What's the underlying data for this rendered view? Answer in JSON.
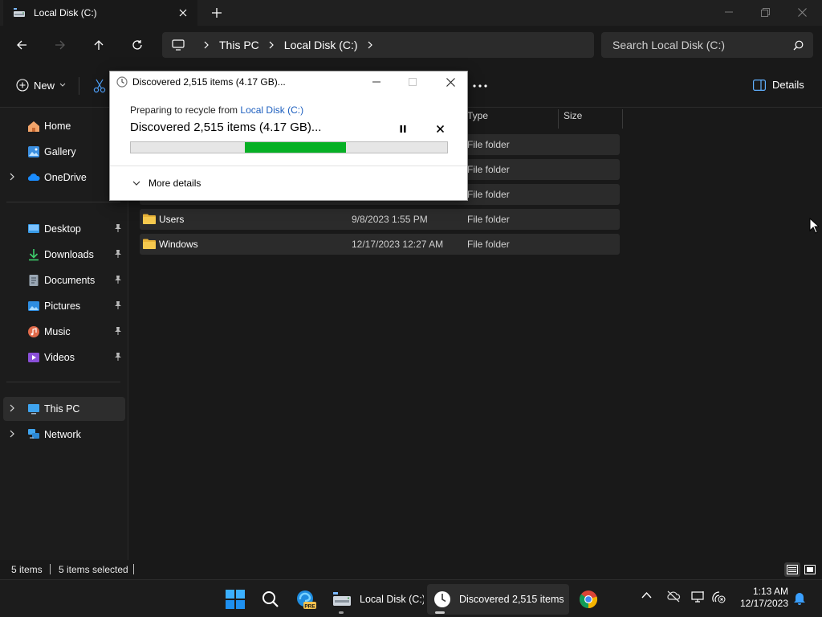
{
  "tab": {
    "title": "Local Disk (C:)"
  },
  "address": {
    "crumbs": [
      "This PC",
      "Local Disk (C:)"
    ]
  },
  "search": {
    "placeholder": "Search Local Disk (C:)"
  },
  "command_bar": {
    "new_label": "New",
    "details_label": "Details"
  },
  "sidebar": {
    "top": [
      {
        "label": "Home",
        "icon": "home-icon"
      },
      {
        "label": "Gallery",
        "icon": "gallery-icon"
      },
      {
        "label": "OneDrive",
        "icon": "onedrive-icon"
      }
    ],
    "pinned": [
      {
        "label": "Desktop",
        "icon": "desktop-icon"
      },
      {
        "label": "Downloads",
        "icon": "downloads-icon"
      },
      {
        "label": "Documents",
        "icon": "documents-icon"
      },
      {
        "label": "Pictures",
        "icon": "pictures-icon"
      },
      {
        "label": "Music",
        "icon": "music-icon"
      },
      {
        "label": "Videos",
        "icon": "videos-icon"
      }
    ],
    "bottom": [
      {
        "label": "This PC",
        "icon": "this-pc-icon",
        "selected": true
      },
      {
        "label": "Network",
        "icon": "network-icon"
      }
    ]
  },
  "file_list": {
    "columns": {
      "type": "Type",
      "size": "Size"
    },
    "rows": [
      {
        "name": "",
        "date": "",
        "type": "File folder"
      },
      {
        "name": "",
        "date": "",
        "type": "File folder"
      },
      {
        "name": "",
        "date": "",
        "type": "File folder"
      },
      {
        "name": "Users",
        "date": "9/8/2023 1:55 PM",
        "type": "File folder"
      },
      {
        "name": "Windows",
        "date": "12/17/2023 12:27 AM",
        "type": "File folder"
      }
    ]
  },
  "status": {
    "items": "5 items",
    "selected": "5 items selected"
  },
  "dialog": {
    "title": "Discovered 2,515 items (4.17 GB)...",
    "subtitle_prefix": "Preparing to recycle from ",
    "subtitle_link": "Local Disk (C:)",
    "main_text": "Discovered 2,515 items (4.17 GB)...",
    "more_details": "More details",
    "progress": {
      "indeterminate": true,
      "fill_start": 0.36,
      "fill_end": 0.68,
      "color": "#06b025"
    }
  },
  "taskbar": {
    "explorer_label": "Local Disk (C:)",
    "progress_label": "Discovered 2,515 items (",
    "time": "1:13 AM",
    "date": "12/17/2023"
  },
  "colors": {
    "accent": "#0078d4",
    "folder": "#f2c14e",
    "progress": "#06b025"
  }
}
